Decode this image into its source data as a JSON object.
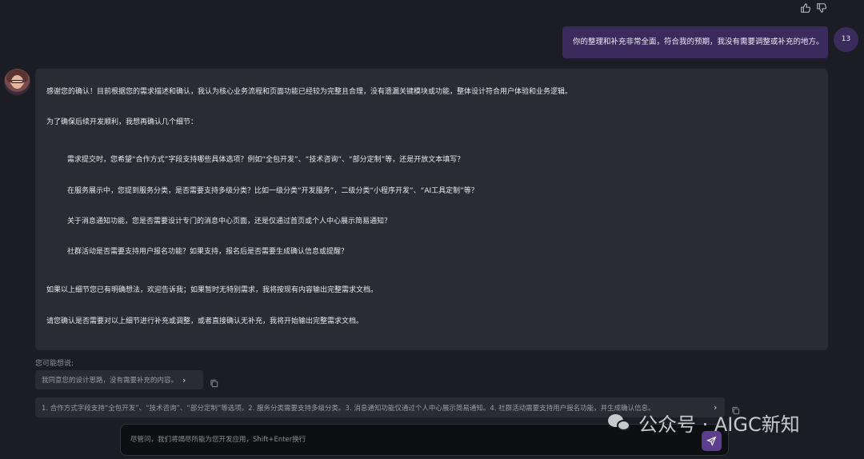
{
  "feedback": {
    "like_icon": "thumbs-up-icon",
    "dislike_icon": "thumbs-down-icon"
  },
  "user_message": {
    "text": "你的整理和补充非常全面，符合我的预期，我没有需要调整或补充的地方。",
    "avatar_label": "13"
  },
  "assistant_message": {
    "avatar_icon": "assistant-avatar",
    "intro": "感谢您的确认！目前根据您的需求描述和确认，我认为核心业务流程和页面功能已经较为完整且合理，没有遗漏关键模块或功能，整体设计符合用户体验和业务逻辑。",
    "lead": "为了确保后续开发顺利，我想再确认几个细节：",
    "questions": [
      "需求提交时，您希望“合作方式”字段支持哪些具体选项？例如“全包开发”、“技术咨询”、“部分定制”等，还是开放文本填写？",
      "在服务展示中，您提到服务分类，是否需要支持多级分类？比如一级分类“开发服务”，二级分类“小程序开发”、“AI工具定制”等？",
      "关于消息通知功能，您是否需要设计专门的消息中心页面，还是仅通过首页或个人中心展示简易通知？",
      "社群活动是否需要支持用户报名功能？如果支持，报名后是否需要生成确认信息或提醒？"
    ],
    "closing_1": "如果以上细节您已有明确想法，欢迎告诉我；如果暂时无特别需求，我将按现有内容输出完整需求文档。",
    "closing_2": "请您确认是否需要对以上细节进行补充或调整，或者直接确认无补充，我将开始输出完整需求文档。"
  },
  "suggestions": {
    "label": "您可能想说:",
    "items": [
      "我同意您的设计思路，没有需要补充的内容。",
      "1. 合作方式字段支持“全包开发”、“技术咨询”、“部分定制”等选项。2. 服务分类需要支持多级分类。3. 消息通知功能仅通过个人中心展示简易通知。4. 社群活动需要支持用户报名功能，并生成确认信息。"
    ]
  },
  "input": {
    "placeholder": "尽管问，我们将竭尽所能为您开发应用，Shift+Enter换行",
    "value": ""
  },
  "watermark": {
    "text": "公众号 · AIGC新知",
    "logo_icon": "wechat-logo-icon"
  },
  "colors": {
    "background": "#1c1d24",
    "bubble": "#2a2b33",
    "user_bubble": "#3b2a5c",
    "accent": "#5c3d8e"
  }
}
